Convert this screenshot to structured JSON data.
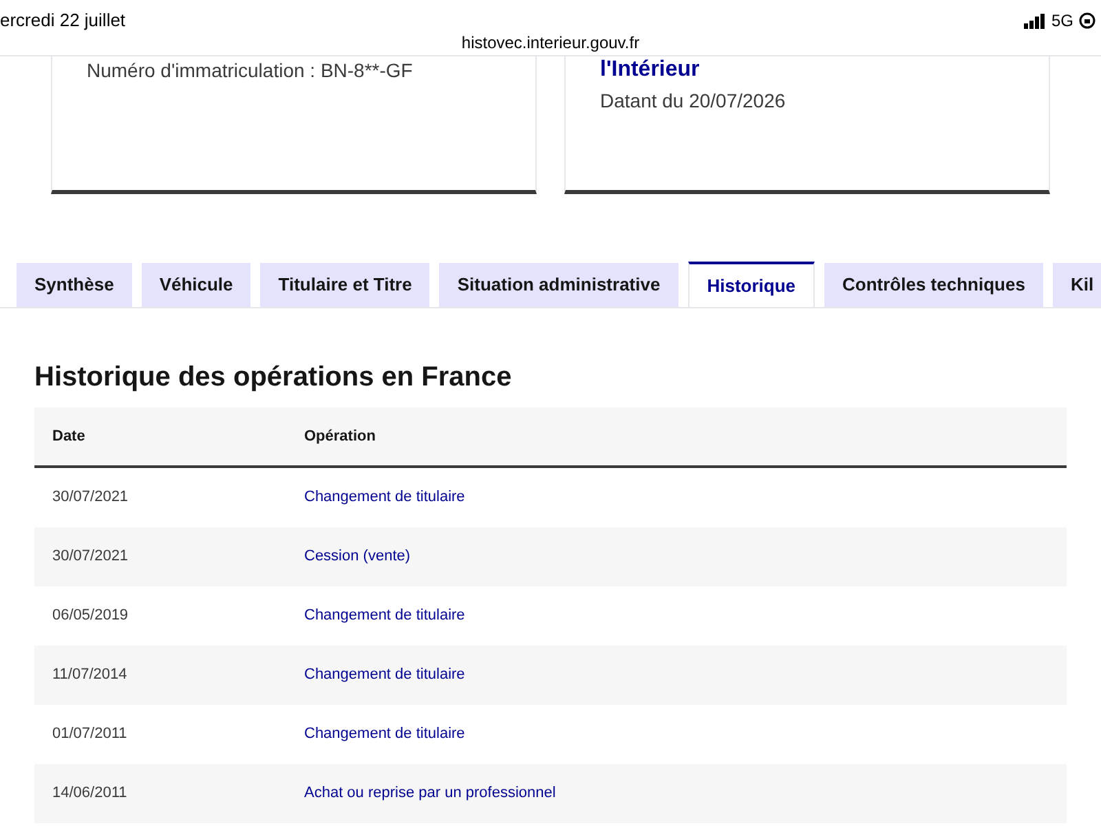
{
  "status_bar": {
    "date": "ercredi 22 juillet",
    "url": "histovec.interieur.gouv.fr",
    "network": "5G"
  },
  "cards": [
    {
      "text": "Numéro d'immatriculation : BN-8**-GF"
    },
    {
      "title": "l'Intérieur",
      "text": "Datant du 20/07/2026"
    }
  ],
  "tabs": [
    {
      "label": "Synthèse",
      "selected": false
    },
    {
      "label": "Véhicule",
      "selected": false
    },
    {
      "label": "Titulaire et Titre",
      "selected": false
    },
    {
      "label": "Situation administrative",
      "selected": false
    },
    {
      "label": "Historique",
      "selected": true
    },
    {
      "label": "Contrôles techniques",
      "selected": false
    },
    {
      "label": "Kil",
      "selected": false
    }
  ],
  "heading": "Historique des opérations en France",
  "table": {
    "columns": [
      "Date",
      "Opération"
    ],
    "rows": [
      [
        "30/07/2021",
        "Changement de titulaire"
      ],
      [
        "30/07/2021",
        "Cession (vente)"
      ],
      [
        "06/05/2019",
        "Changement de titulaire"
      ],
      [
        "11/07/2014",
        "Changement de titulaire"
      ],
      [
        "01/07/2011",
        "Changement de titulaire"
      ],
      [
        "14/06/2011",
        "Achat ou reprise par un professionnel"
      ]
    ]
  }
}
